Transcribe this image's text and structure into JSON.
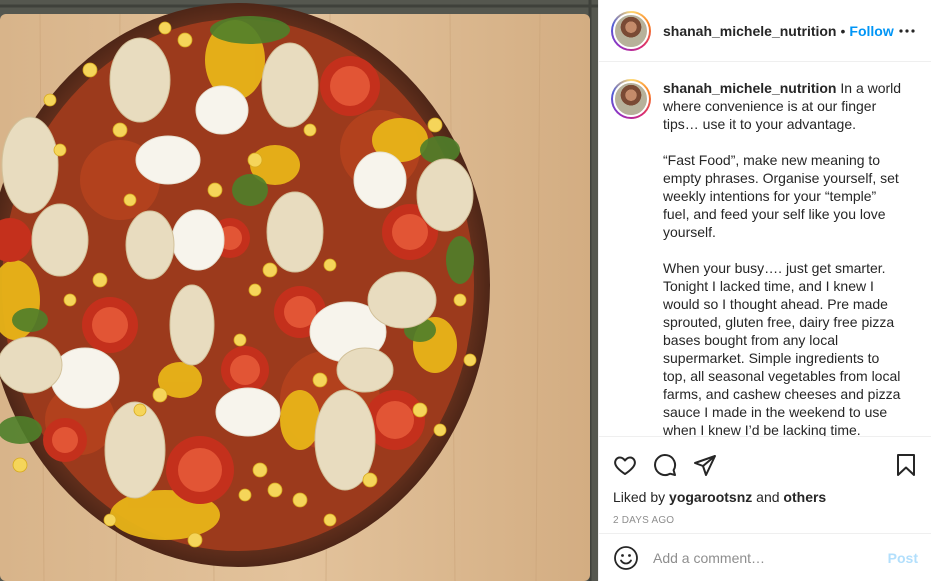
{
  "post": {
    "username": "shanah_michele_nutrition",
    "follow_label": "Follow",
    "separator": "•",
    "image_alt": "Pizza with tomatoes, corn, cashew cheese and greens on a wooden board",
    "caption": {
      "username": "shanah_michele_nutrition",
      "paragraphs": [
        " In a world where convenience is at our finger tips… use it to your advantage.",
        "“Fast Food”, make new meaning to empty phrases. Organise yourself, set weekly intentions for your “temple” fuel, and feed your self like you love yourself.",
        "When your busy…. just get smarter. Tonight I lacked time, and I knew I would so I thought ahead. Pre made sprouted, gluten free, dairy free pizza bases bought from any local supermarket. Simple ingredients to top, all seasonal vegetables from local farms, and cashew cheeses and pizza sauce I made in the weekend to use when I knew I’d be lacking time."
      ]
    },
    "likes": {
      "prefix": "Liked by ",
      "user": "yogarootsnz",
      "joiner": " and ",
      "others": "others"
    },
    "timestamp": "2 DAYS AGO",
    "comment_placeholder": "Add a comment…",
    "post_label": "Post",
    "icons": {
      "like": "heart-icon",
      "comment": "comment-icon",
      "share": "share-icon",
      "save": "bookmark-icon",
      "more": "more-icon",
      "emoji": "emoji-icon"
    },
    "colors": {
      "follow": "#0095f6",
      "post_disabled": "#b2dffc",
      "muted": "#8e8e8e",
      "text": "#262626"
    }
  }
}
